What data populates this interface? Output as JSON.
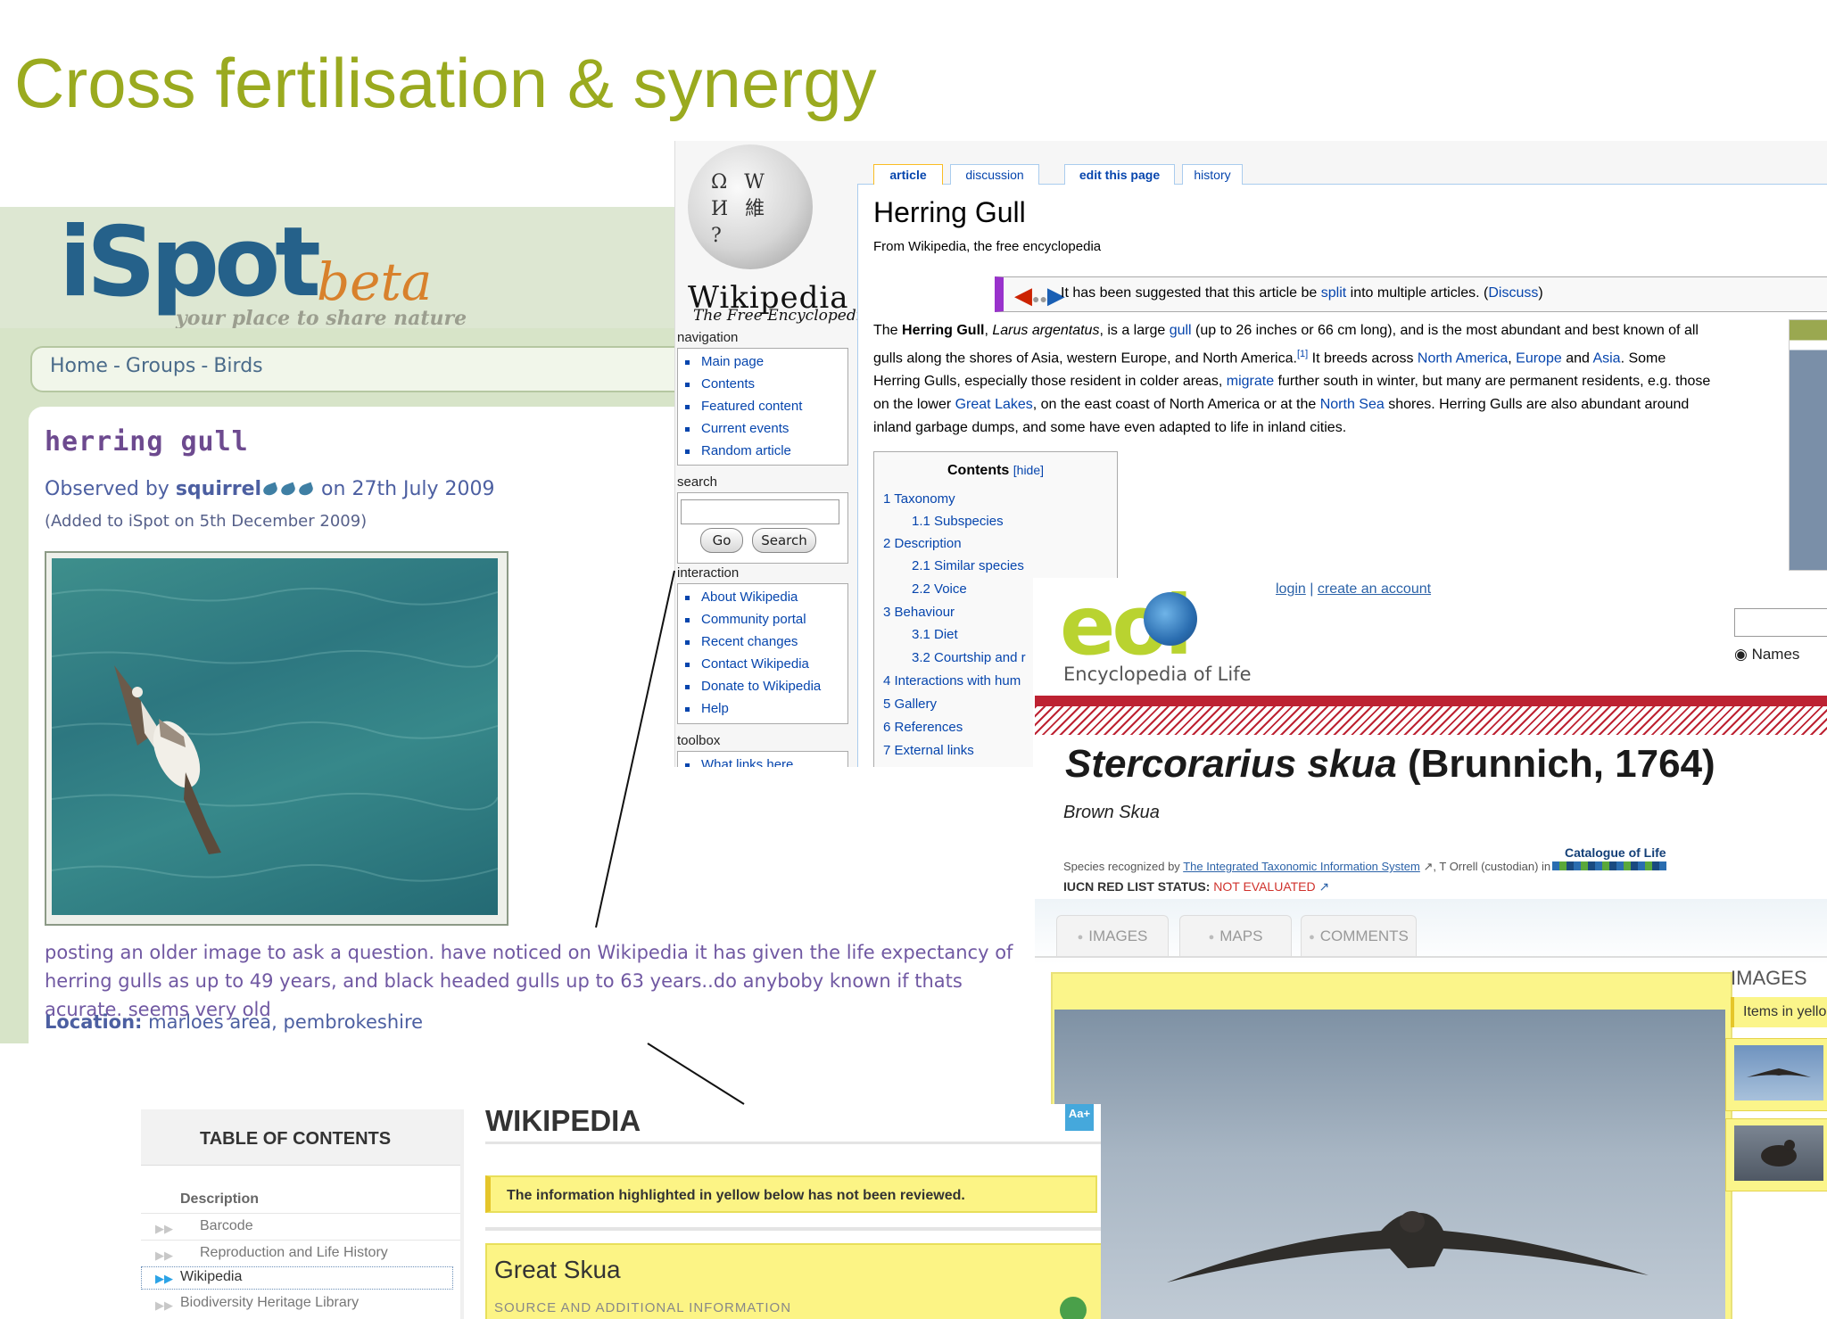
{
  "slide": {
    "title": "Cross fertilisation & synergy"
  },
  "ispot": {
    "logo": "iSpot",
    "beta": "beta",
    "tagline": "your place to share nature",
    "breadcrumb": [
      "Home",
      "Groups",
      "Birds"
    ],
    "title": "herring gull",
    "observed_prefix": "Observed by",
    "observer": "squirrel",
    "observed_date": "on 27th July 2009",
    "added": "(Added to iSpot on 5th December 2009)",
    "question": "posting an older image to ask a question. have noticed on Wikipedia it has given the life expectancy of herring gulls as up to 49 years, and black headed gulls up to 63 years..do anyboby known if thats acurate. seems very old",
    "location_label": "Location:",
    "location": "marloes area, pembrokeshire"
  },
  "wikipedia": {
    "wordmark": "Wikipedia",
    "tagline": "The Free Encyclopedia",
    "globe_glyphs": "Ω W И 維 ?",
    "navigation_label": "navigation",
    "navigation": [
      "Main page",
      "Contents",
      "Featured content",
      "Current events",
      "Random article"
    ],
    "search_label": "search",
    "search_buttons": {
      "go": "Go",
      "search": "Search"
    },
    "interaction_label": "interaction",
    "interaction": [
      "About Wikipedia",
      "Community portal",
      "Recent changes",
      "Contact Wikipedia",
      "Donate to Wikipedia",
      "Help"
    ],
    "toolbox_label": "toolbox",
    "toolbox": [
      "What links here"
    ],
    "tabs": [
      "article",
      "discussion",
      "edit this page",
      "history"
    ],
    "title": "Herring Gull",
    "subtitle": "From Wikipedia, the free encyclopedia",
    "split_notice": {
      "before": "It has been suggested that this article be ",
      "link": "split",
      "middle": " into multiple articles. (",
      "discuss": "Discuss",
      "after": ")"
    },
    "lead": {
      "l1a": "The ",
      "l1b": "Herring Gull",
      "l1c": ", ",
      "l1d": "Larus argentatus",
      "l1e": ", is a large ",
      "l1f": "gull",
      "l1g": " (up to 26 inches or 66 cm long), and is the most abundant and best known of all",
      "l2a": "gulls along the shores of Asia, western Europe, and North America.",
      "l2b": "[1]",
      "l2c": " It breeds across ",
      "l2d": "North America",
      "l2e": ", ",
      "l2f": "Europe",
      "l2g": " and ",
      "l2h": "Asia",
      "l2i": ". Some",
      "l3a": "Herring Gulls, especially those resident in colder areas, ",
      "l3b": "migrate",
      "l3c": " further south in winter, but many are permanent residents, e.g. those",
      "l4a": "on the lower ",
      "l4b": "Great Lakes",
      "l4c": ", on the east coast of North America or at the ",
      "l4d": "North Sea",
      "l4e": " shores. Herring Gulls are also abundant around",
      "l5": "inland garbage dumps, and some have even adapted to life in inland cities."
    },
    "toc": {
      "title": "Contents",
      "hide": "[hide]",
      "items": [
        "1 Taxonomy",
        "1.1 Subspecies",
        "2 Description",
        "2.1 Similar species",
        "2.2 Voice",
        "3 Behaviour",
        "3.1 Diet",
        "3.2 Courtship and r",
        "4 Interactions with hum",
        "5 Gallery",
        "6 References",
        "7 External links"
      ]
    }
  },
  "eol": {
    "logo": "eol",
    "tagline": "Encyclopedia of Life",
    "login": "login",
    "sep": " | ",
    "create_account": "create an account",
    "names": "Names",
    "title_sci": "Stercorarius skua",
    "title_author": " (Brunnich, 1764)",
    "common_name": "Brown Skua",
    "recognized_prefix": "Species recognized by ",
    "recognized_link": "The Integrated Taxonomic Information System",
    "recognized_suffix": ", T Orrell (custodian) in",
    "catalogue": "Catalogue of Life",
    "iucn_label": "IUCN RED LIST STATUS: ",
    "iucn_value": "NOT EVALUATED",
    "tabs": [
      "IMAGES",
      "MAPS",
      "COMMENTS"
    ],
    "images_label": "IMAGES",
    "items_note": "Items in yello"
  },
  "wikipedia_mobile": {
    "toc_title": "TABLE OF CONTENTS",
    "toc_items": [
      "Description",
      "Barcode",
      "Reproduction and Life History",
      "Wikipedia",
      "Biodiversity Heritage Library"
    ],
    "logo": "WIKIPEDIA",
    "aa": "Aa+",
    "notice": "The information highlighted in yellow below has not been reviewed.",
    "heading": "Great Skua",
    "source": "SOURCE AND ADDITIONAL INFORMATION"
  },
  "colors": {
    "slide_title": "#9aaa1f",
    "ispot_blue": "#25618a",
    "ispot_orange": "#d8812c",
    "wiki_link": "#0645ad",
    "eol_red": "#bd2232",
    "eol_green": "#b9d330",
    "highlight_yellow": "#fcf485"
  },
  "icons": [
    "wikipedia-globe",
    "split-arrows",
    "external-link",
    "aa-text-size",
    "plus-circle",
    "bullet",
    "chevron-right"
  ]
}
